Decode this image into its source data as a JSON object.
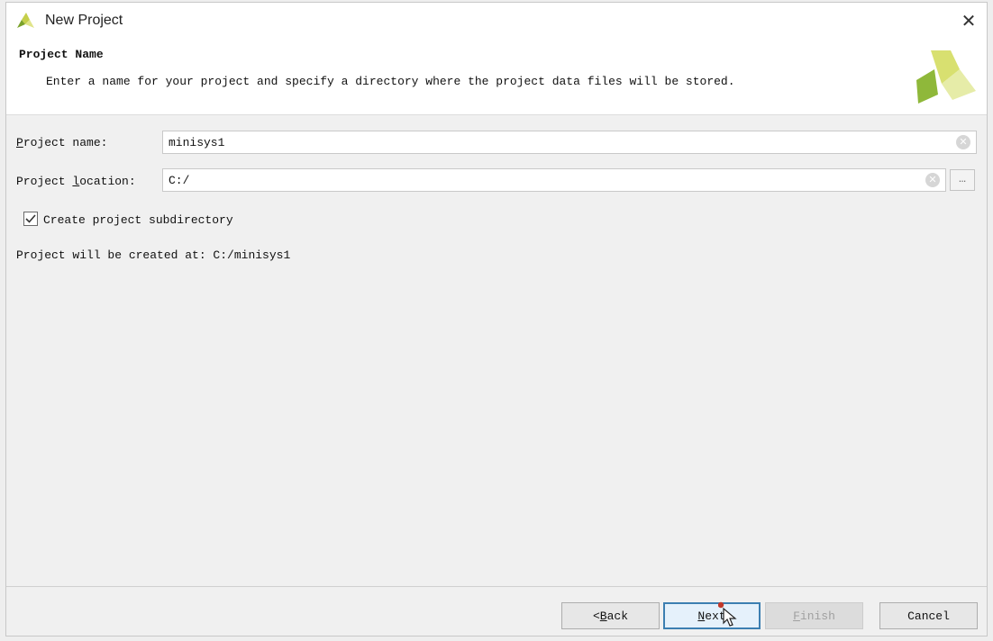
{
  "window": {
    "title": "New Project",
    "close_glyph": "✕"
  },
  "header": {
    "title": "Project Name",
    "description": "Enter a name for your project and specify a directory where the project data files will be stored."
  },
  "form": {
    "name_label": {
      "mnemonic": "P",
      "rest": "roject name:"
    },
    "name_value": "minisys1",
    "location_label": {
      "before": "Project ",
      "mnemonic": "l",
      "after": "ocation:"
    },
    "location_value": "C:/",
    "browse_label": "…",
    "create_subdir_label": "Create project subdirectory",
    "create_subdir_checked": true,
    "created_at_text": "Project will be created at: C:/minisys1"
  },
  "footer": {
    "back": {
      "prefix": "< ",
      "mnemonic": "B",
      "rest": "ack"
    },
    "next": {
      "mnemonic": "N",
      "rest": "ext"
    },
    "finish": {
      "mnemonic": "F",
      "rest": "inish"
    },
    "cancel": "Cancel"
  },
  "colors": {
    "accent": "#3c7fb1",
    "brand_green": "#8fb83a",
    "brand_yellow": "#d9e27a"
  },
  "icons": [
    "vivado-logo-icon",
    "close-icon",
    "clear-icon",
    "checkbox-checked-icon",
    "mouse-pointer-icon"
  ]
}
